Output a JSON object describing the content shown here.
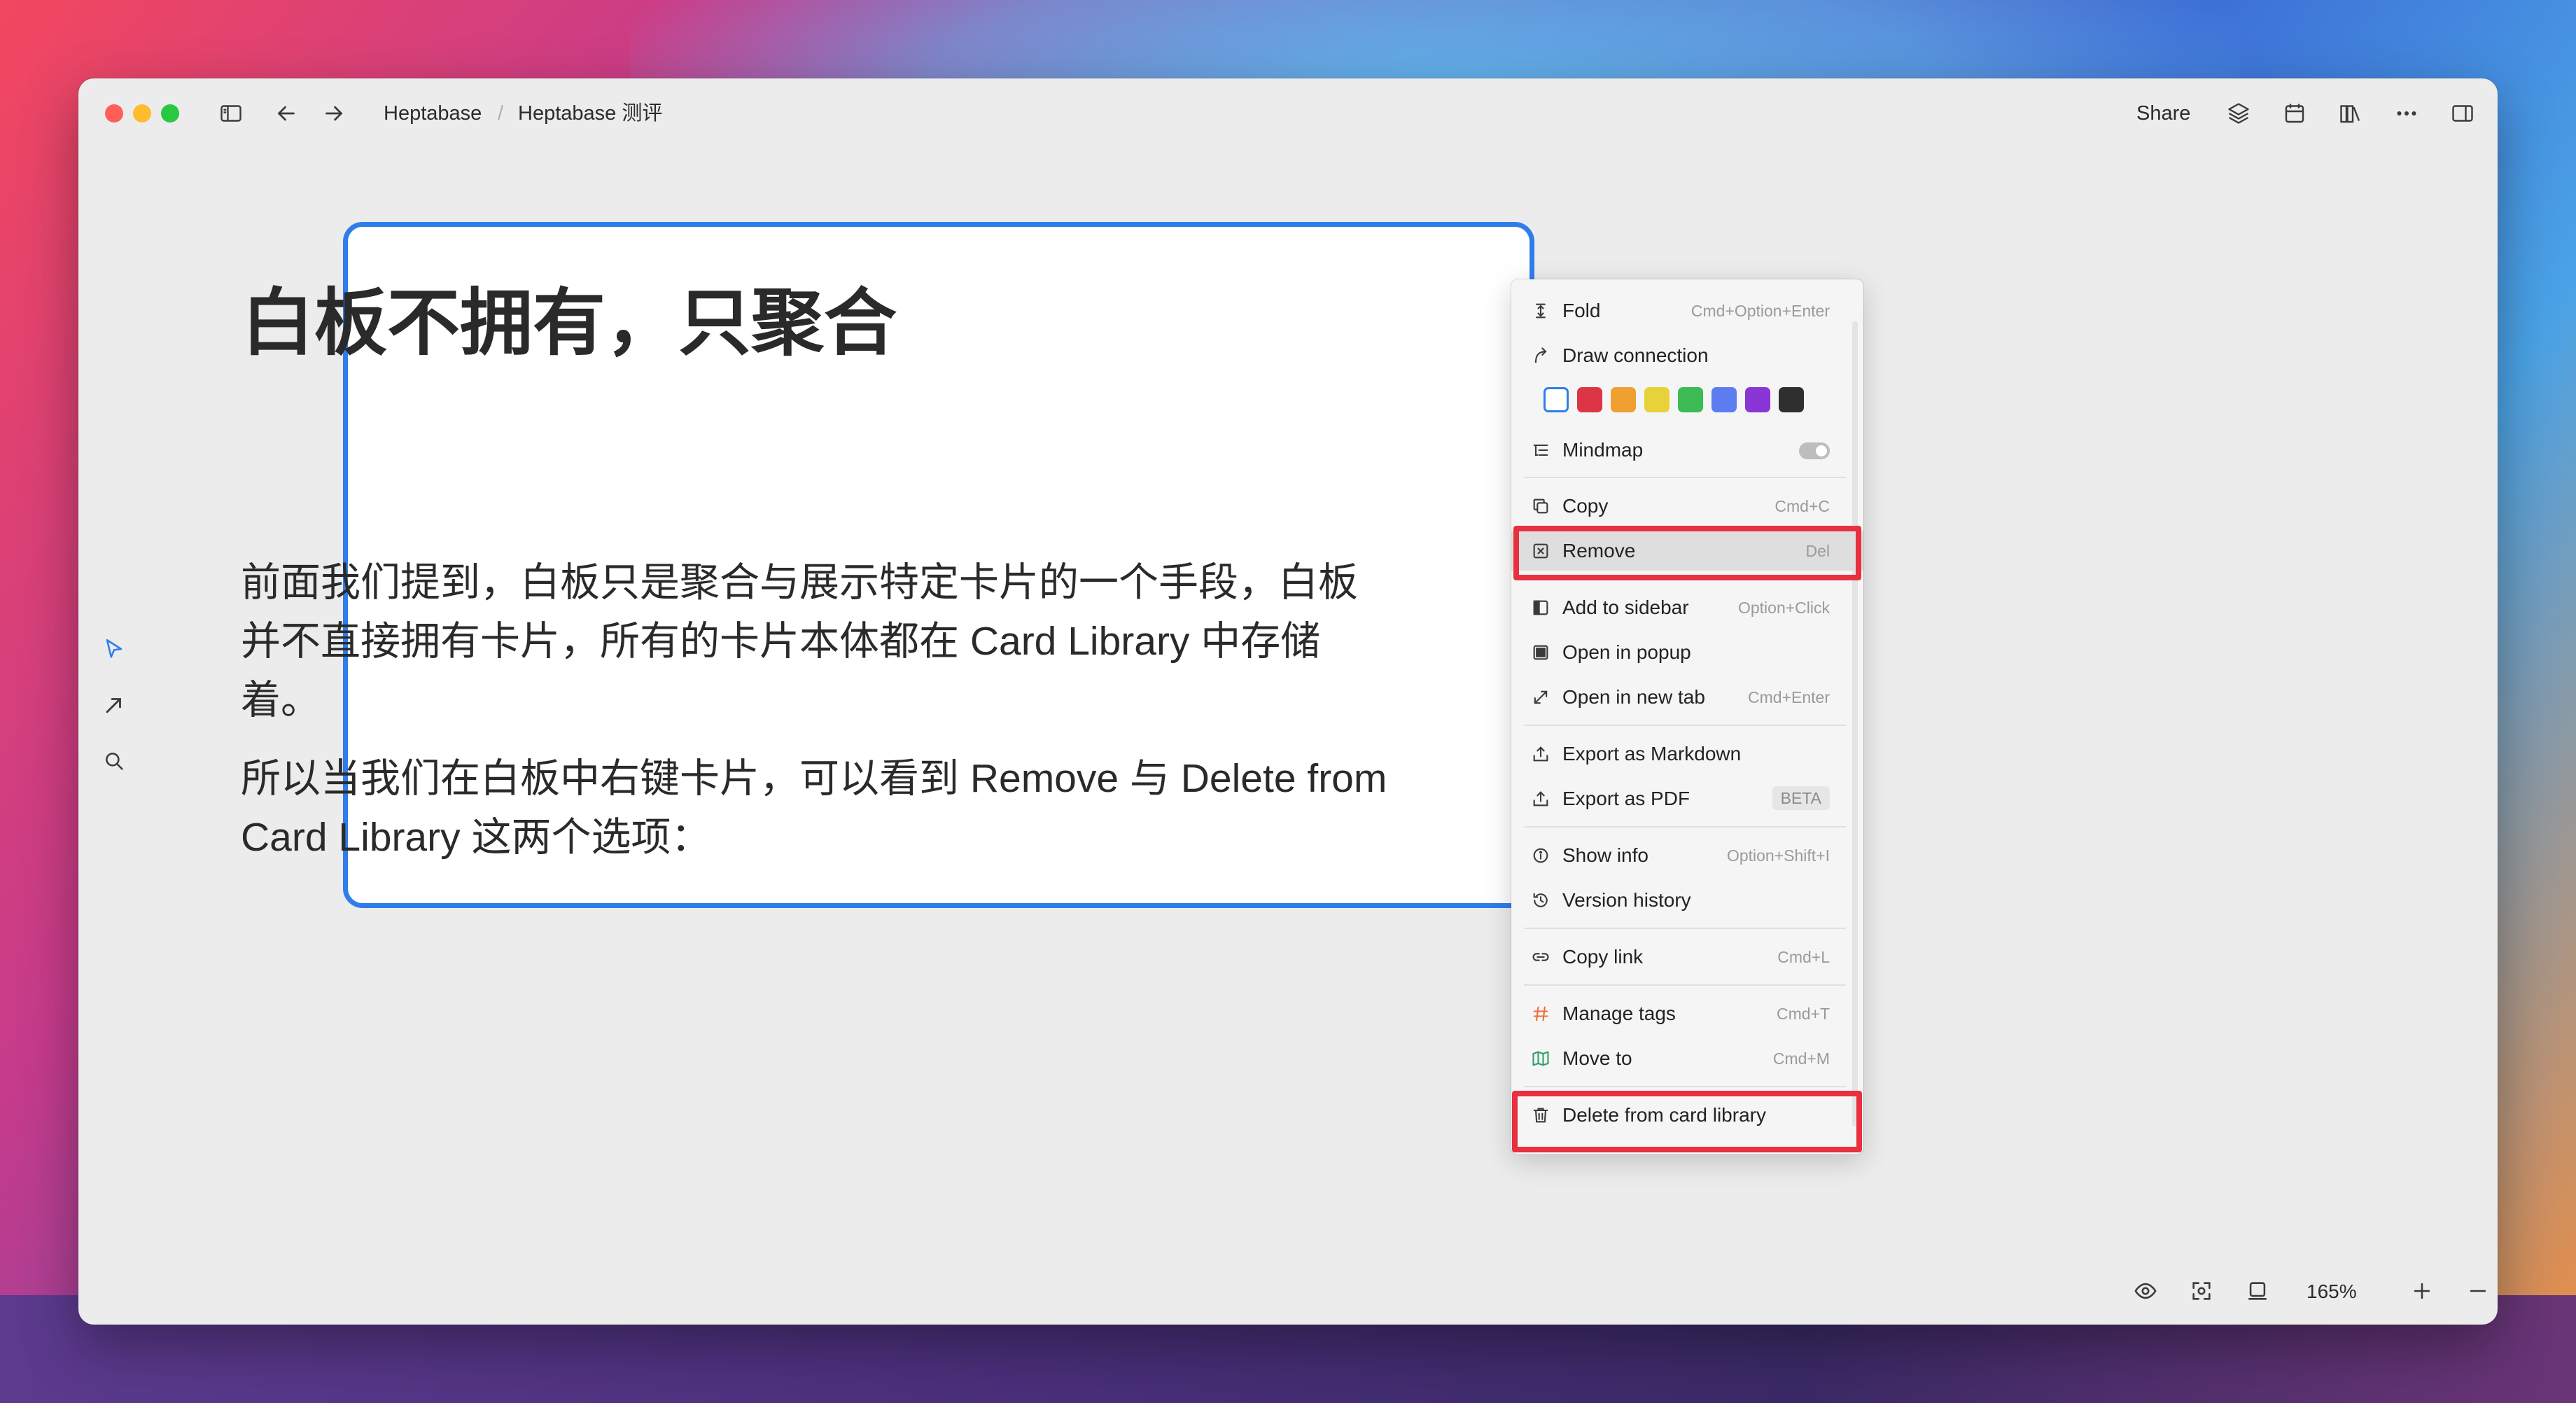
{
  "colors": {
    "accent": "#2f7de9",
    "highlight_red": "#e8303f",
    "window_bg": "#ececec"
  },
  "titlebar": {
    "breadcrumb_root": "Heptabase",
    "breadcrumb_separator": "/",
    "breadcrumb_current": "Heptabase 测评",
    "share_label": "Share"
  },
  "card": {
    "title": "白板不拥有，只聚合",
    "paragraph_1": "前面我们提到，白板只是聚合与展示特定卡片的一个手段，白板并不直接拥有卡片，所有的卡片本体都在 Card Library 中存储着。",
    "paragraph_2": "所以当我们在白板中右键卡片，可以看到 Remove 与 Delete from Card Library 这两个选项："
  },
  "context_menu": {
    "fold": {
      "label": "Fold",
      "shortcut": "Cmd+Option+Enter"
    },
    "draw_connection": {
      "label": "Draw connection"
    },
    "swatch_colors": [
      "#ffffff",
      "#dc3545",
      "#f0a030",
      "#e8d23a",
      "#3cba54",
      "#5c7cf0",
      "#8a35d6",
      "#2f2f2f"
    ],
    "mindmap": {
      "label": "Mindmap"
    },
    "copy": {
      "label": "Copy",
      "shortcut": "Cmd+C"
    },
    "remove": {
      "label": "Remove",
      "shortcut": "Del"
    },
    "add_to_sidebar": {
      "label": "Add to sidebar",
      "shortcut": "Option+Click"
    },
    "open_in_popup": {
      "label": "Open in popup"
    },
    "open_in_new_tab": {
      "label": "Open in new tab",
      "shortcut": "Cmd+Enter"
    },
    "export_markdown": {
      "label": "Export as Markdown"
    },
    "export_pdf": {
      "label": "Export as PDF",
      "badge": "BETA"
    },
    "show_info": {
      "label": "Show info",
      "shortcut": "Option+Shift+I"
    },
    "version_history": {
      "label": "Version history"
    },
    "copy_link": {
      "label": "Copy link",
      "shortcut": "Cmd+L"
    },
    "manage_tags": {
      "label": "Manage tags",
      "shortcut": "Cmd+T"
    },
    "move_to": {
      "label": "Move to",
      "shortcut": "Cmd+M"
    },
    "delete_from_library": {
      "label": "Delete from card library"
    }
  },
  "bottom_bar": {
    "zoom_level": "165%"
  }
}
